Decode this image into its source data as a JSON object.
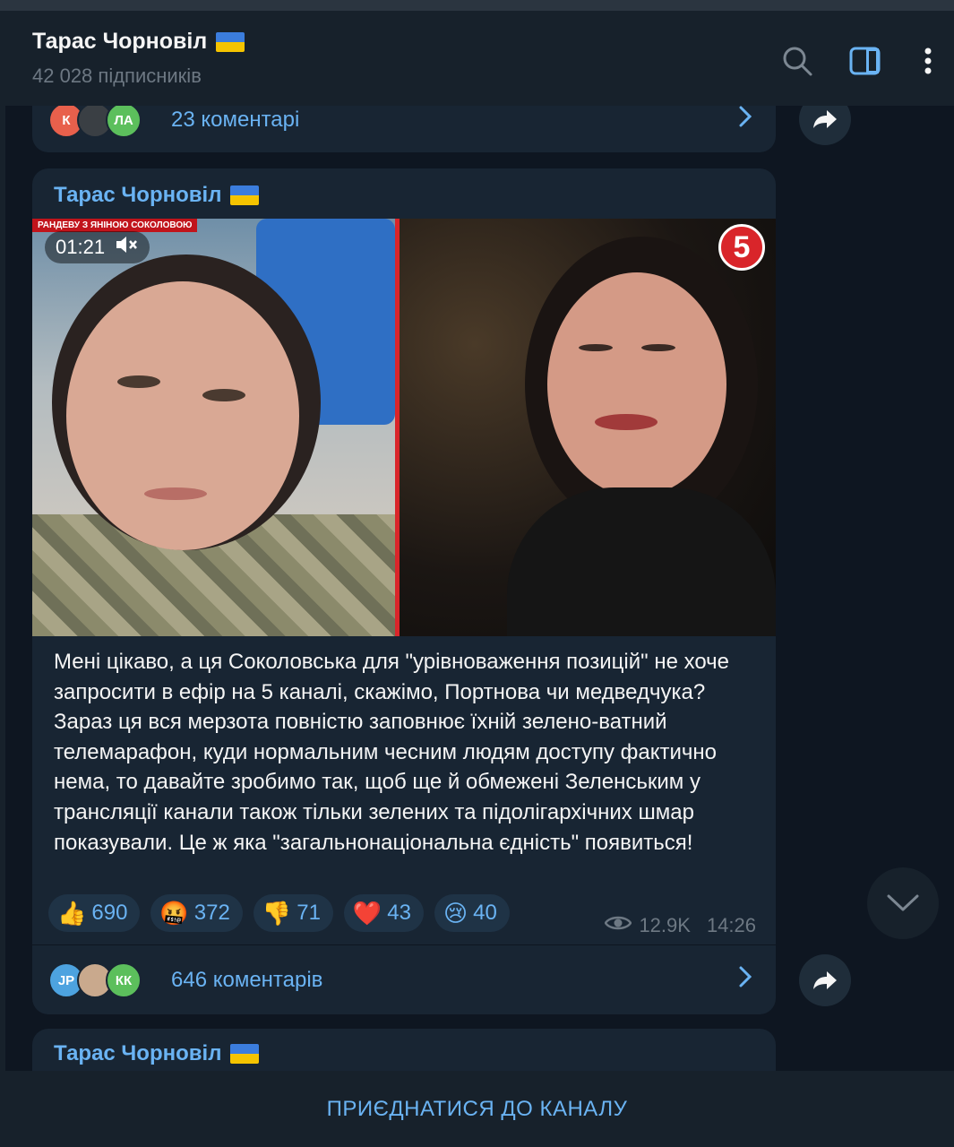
{
  "header": {
    "title": "Тарас Чорновіл",
    "subscribers": "42 028 підписників",
    "flag_colors": [
      "#3b7ddd",
      "#f5c400"
    ],
    "icons": [
      "search-icon",
      "sidebar-toggle-icon",
      "more-vertical-icon"
    ]
  },
  "prev_post": {
    "comments_label": "23 коментарі",
    "avatars": [
      {
        "initials": "К",
        "color": "#e8604c"
      },
      {
        "initials": "",
        "color": "#3a3f44"
      },
      {
        "initials": "ЛА",
        "color": "#5cbf5c"
      }
    ]
  },
  "post": {
    "author": "Тарас Чорновіл",
    "video": {
      "duration": "01:21",
      "show_label": "РАНДЕВУ З ЯНІНОЮ СОКОЛОВОЮ",
      "channel_badge": "5"
    },
    "text": "Мені цікаво, а ця Соколовська для \"урівноваження позицій\" не хоче запросити в ефір на 5 каналі, скажімо, Портнова чи медведчука? Зараз ця вся мерзота повністю заповнює їхній зелено-ватний телемарафон, куди нормальним чесним людям доступу фактично нема, то давайте зробимо так, щоб ще й обмежені Зеленським у трансляції канали також тільки зелених та підолігархічних шмар показували. Це ж яка \"загальнонаціональна єдність\" появиться!",
    "reactions": [
      {
        "emoji": "👍",
        "count": "690"
      },
      {
        "emoji": "🤬",
        "count": "372"
      },
      {
        "emoji": "👎",
        "count": "71"
      },
      {
        "emoji": "❤️",
        "count": "43"
      },
      {
        "emoji": "😢",
        "count": "40"
      }
    ],
    "views": "12.9K",
    "time": "14:26",
    "comments_label": "646 коментарів",
    "avatars": [
      {
        "initials": "JP",
        "color": "#4da3e0"
      },
      {
        "initials": "",
        "color": "#c9a98d"
      },
      {
        "initials": "КК",
        "color": "#5cbf5c"
      }
    ]
  },
  "next_post": {
    "author": "Тарас Чорновіл"
  },
  "footer": {
    "join_label": "ПРИЄДНАТИСЯ ДО КАНАЛУ"
  },
  "colors": {
    "background": "#0e1621",
    "bubble": "#182533",
    "accent": "#6ab3f3",
    "muted": "#6d7883"
  }
}
